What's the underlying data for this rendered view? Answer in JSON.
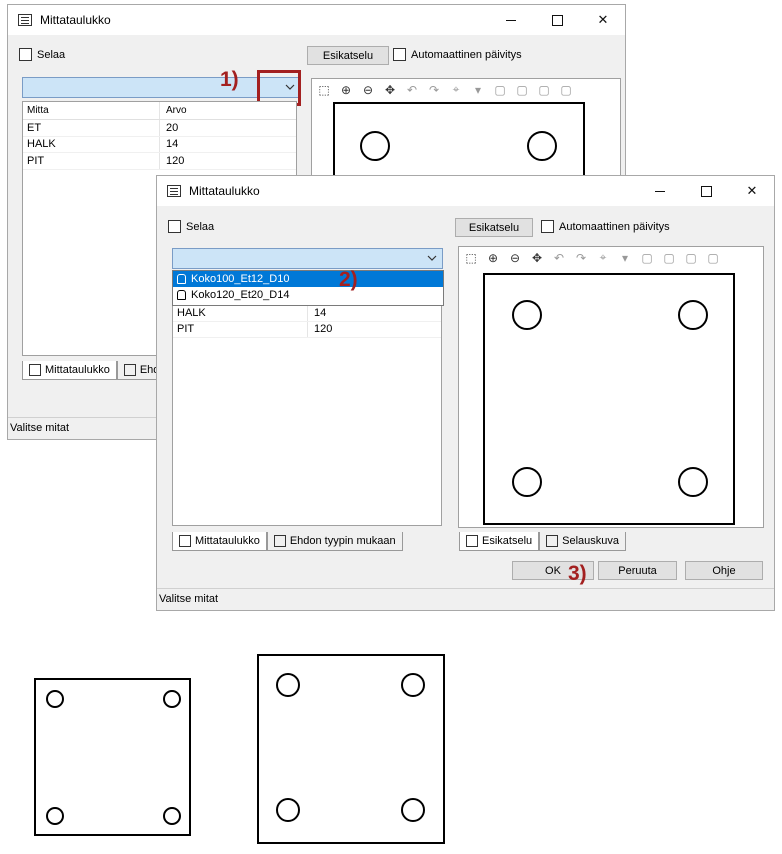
{
  "window_back": {
    "title": "Mittataulukko",
    "browse_label": "Selaa",
    "preview_button": "Esikatselu",
    "auto_update_label": "Automaattinen päivitys",
    "columns": [
      "Mitta",
      "Arvo"
    ],
    "rows": [
      [
        "ET",
        "20"
      ],
      [
        "HALK",
        "14"
      ],
      [
        "PIT",
        "120"
      ]
    ],
    "tabs": [
      "Mittataulukko",
      "Ehd"
    ],
    "status": "Valitse mitat"
  },
  "window_front": {
    "title": "Mittataulukko",
    "browse_label": "Selaa",
    "preview_button": "Esikatselu",
    "auto_update_label": "Automaattinen päivitys",
    "dropdown_options": [
      "Koko100_Et12_D10",
      "Koko120_Et20_D14"
    ],
    "selected_option_index": 0,
    "partial_row": "PI",
    "partial_value": "...",
    "rows": [
      [
        "HALK",
        "14"
      ],
      [
        "PIT",
        "120"
      ]
    ],
    "tabs": [
      "Mittataulukko",
      "Ehdon tyypin mukaan"
    ],
    "preview_tabs": [
      "Esikatselu",
      "Selauskuva"
    ],
    "buttons": {
      "ok": "OK",
      "cancel": "Peruuta",
      "help": "Ohje"
    },
    "status": "Valitse mitat"
  },
  "annotations": [
    "1)",
    "2)",
    "3)"
  ],
  "colors": {
    "annotation": "#a32020",
    "selection": "#0078d7",
    "combo": "#cce4f7"
  }
}
